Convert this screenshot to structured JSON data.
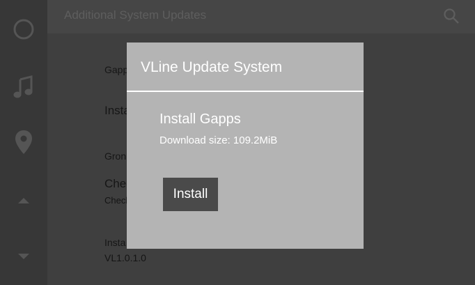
{
  "header": {
    "title": "Additional System Updates",
    "search_icon": "search-icon"
  },
  "nav": {
    "items": [
      "circle-icon",
      "music-note-icon",
      "location-pin-icon",
      "arrow-up-icon",
      "arrow-down-icon"
    ]
  },
  "list": {
    "rows": [
      {
        "primary": "Gapps"
      },
      {
        "primary": "Install"
      },
      {
        "primary": "Gron"
      },
      {
        "primary": "Check",
        "secondary": "Check"
      },
      {
        "primary": "Insta",
        "secondary": "VL1.0.1.0"
      }
    ]
  },
  "dialog": {
    "title": "VLine Update System",
    "item_title": "Install Gapps",
    "item_subtitle": "Download size: 109.2MiB",
    "install_label": "Install"
  },
  "colors": {
    "dialog_bg": "#b4b4b4",
    "button_bg": "#4a4a4a",
    "overlay_bg": "#3f3f3f"
  }
}
